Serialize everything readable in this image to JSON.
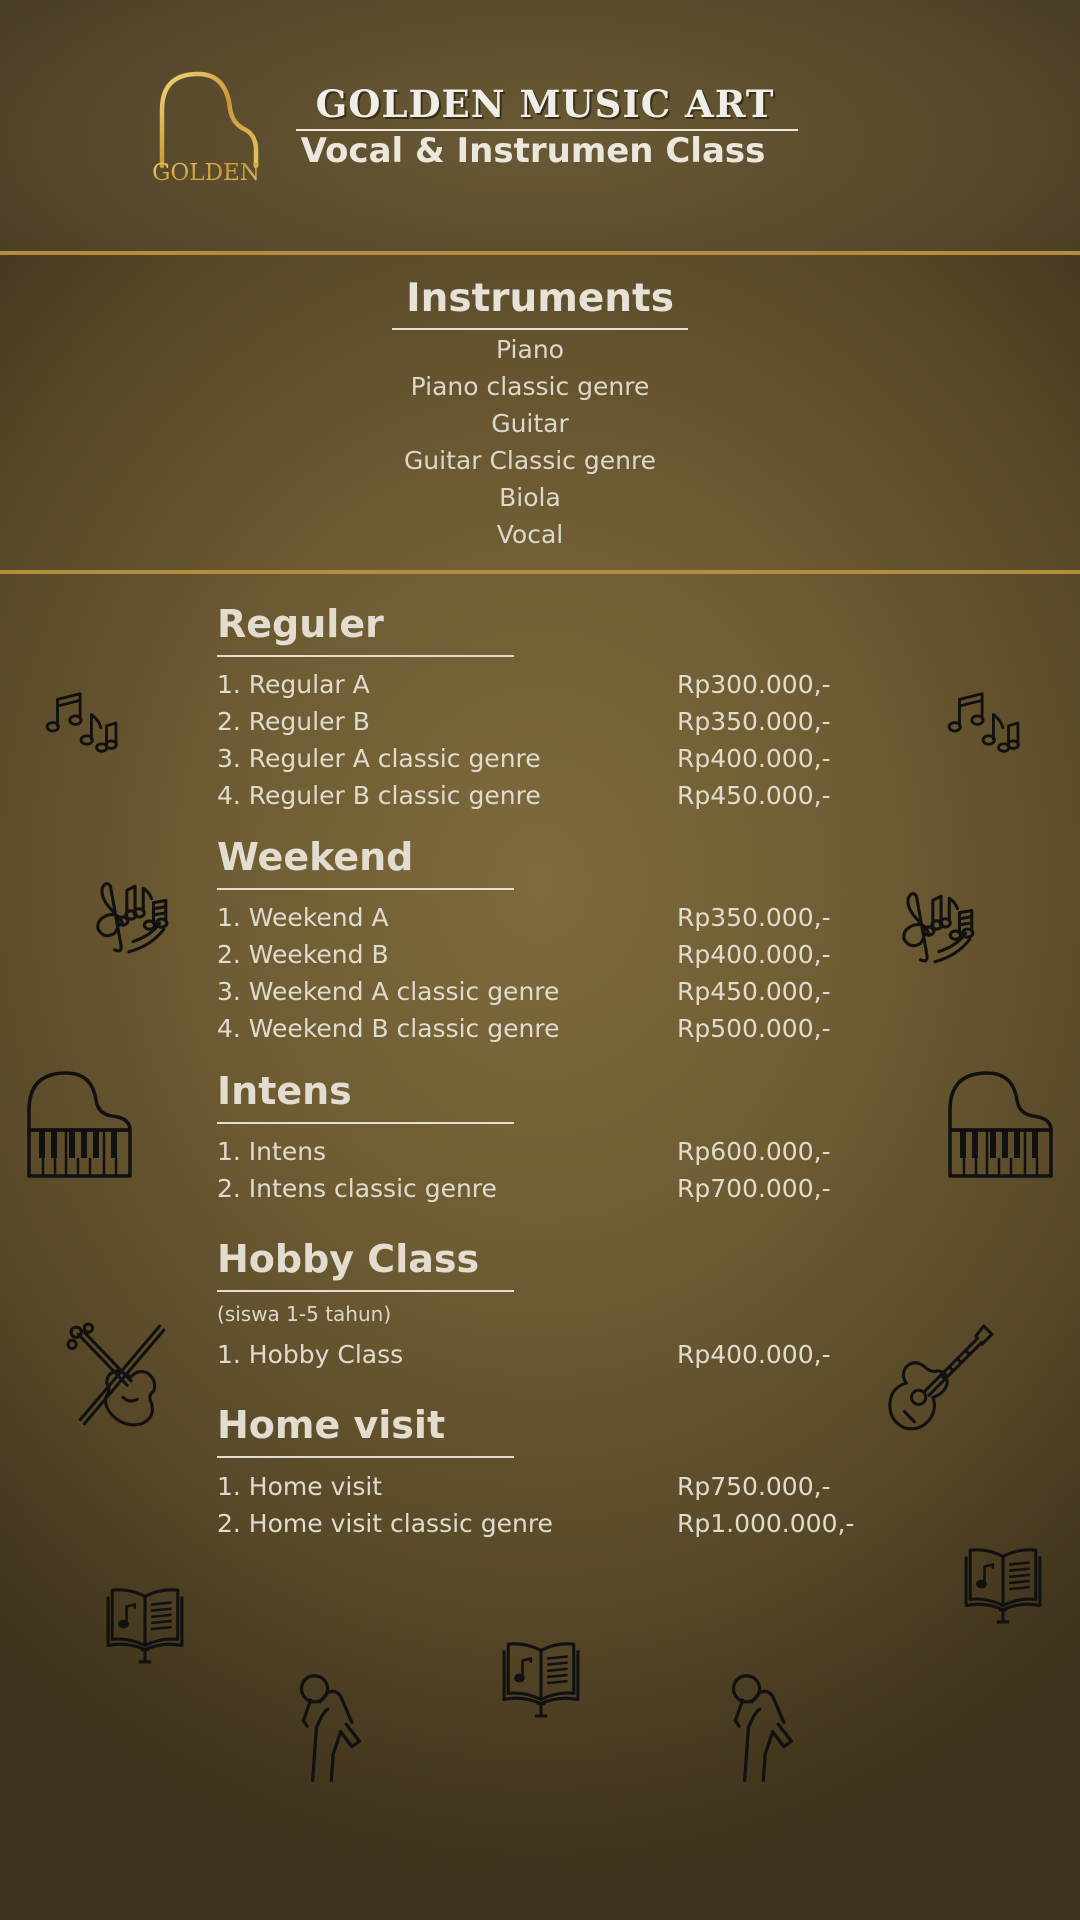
{
  "header": {
    "logo_text": "GOLDEN",
    "title": "GOLDEN MUSIC ART",
    "subtitle": "Vocal & Instrumen Class"
  },
  "instruments": {
    "title": "Instruments",
    "items": [
      "Piano",
      "Piano classic genre",
      "Guitar",
      "Guitar Classic genre",
      "Biola",
      "Vocal"
    ]
  },
  "sections": [
    {
      "title": "Reguler",
      "rows": [
        {
          "name": "1. Regular A",
          "price": "Rp300.000,-"
        },
        {
          "name": "2. Reguler B",
          "price": "Rp350.000,-"
        },
        {
          "name": "3. Reguler A classic genre",
          "price": "Rp400.000,-"
        },
        {
          "name": "4. Reguler B classic genre",
          "price": "Rp450.000,-"
        }
      ]
    },
    {
      "title": "Weekend",
      "rows": [
        {
          "name": "1. Weekend A",
          "price": "Rp350.000,-"
        },
        {
          "name": "2. Weekend B",
          "price": "Rp400.000,-"
        },
        {
          "name": "3. Weekend A classic genre",
          "price": "Rp450.000,-"
        },
        {
          "name": "4. Weekend B classic genre",
          "price": "Rp500.000,-"
        }
      ]
    },
    {
      "title": "Intens",
      "rows": [
        {
          "name": "1. Intens",
          "price": "Rp600.000,-"
        },
        {
          "name": "2. Intens classic genre",
          "price": "Rp700.000,-"
        }
      ]
    },
    {
      "title": "Hobby Class",
      "note": "(siswa 1-5 tahun)",
      "rows": [
        {
          "name": "1. Hobby Class",
          "price": "Rp400.000,-"
        }
      ]
    },
    {
      "title": "Home visit",
      "rows": [
        {
          "name": "1. Home visit",
          "price": "Rp750.000,-"
        },
        {
          "name": "2. Home visit classic genre",
          "price": "Rp1.000.000,-"
        }
      ]
    }
  ],
  "icons": [
    "music-notes-icon",
    "music-notes-swirl-icon",
    "grand-piano-icon",
    "violin-icon",
    "guitar-icon",
    "music-book-icon",
    "singer-microphone-icon"
  ],
  "colors": {
    "accent_gold": "#b38d3d",
    "text": "#e6e1d6"
  }
}
